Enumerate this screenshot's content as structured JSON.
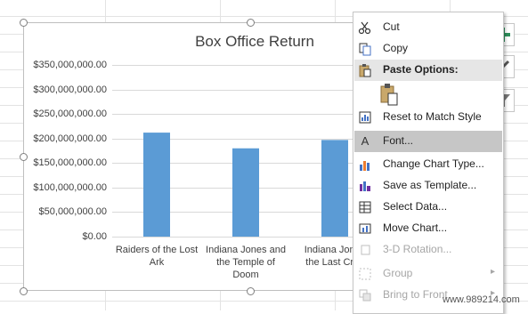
{
  "chart_data": {
    "type": "bar",
    "title": "Box Office Return",
    "categories": [
      "Raiders of the Lost Ark",
      "Indiana Jones and the Temple of Doom",
      "Indiana Jones and the Last Crusade"
    ],
    "category_label_lines": [
      [
        "Raiders of the Lost",
        "Ark"
      ],
      [
        "Indiana Jones and",
        "the Temple of",
        "Doom"
      ],
      [
        "Indiana Jones",
        "the Last Crus"
      ]
    ],
    "values": [
      212000000,
      180000000,
      197000000
    ],
    "ylim": [
      0,
      350000000
    ],
    "yticks": [
      0,
      50000000,
      100000000,
      150000000,
      200000000,
      250000000,
      300000000,
      350000000
    ],
    "ytick_labels": [
      "$0.00",
      "$50,000,000.00",
      "$100,000,000.00",
      "$150,000,000.00",
      "$200,000,000.00",
      "$250,000,000.00",
      "$300,000,000.00",
      "$350,000,000.00"
    ],
    "xlabel": "",
    "ylabel": "",
    "grid": true,
    "legend": "none",
    "bar_color": "#5b9bd5"
  },
  "side_buttons": [
    {
      "icon": "plus-icon"
    },
    {
      "icon": "brush-icon"
    },
    {
      "icon": "filter-icon"
    }
  ],
  "context_menu": {
    "items": [
      {
        "id": "cut",
        "label": "Cut",
        "icon": "scissors-icon",
        "state": "normal"
      },
      {
        "id": "copy",
        "label": "Copy",
        "icon": "copy-icon",
        "state": "normal"
      },
      {
        "id": "paste-options",
        "label": "Paste Options:",
        "icon": "clipboard-icon",
        "state": "section"
      },
      {
        "id": "reset-style",
        "label": "Reset to Match Style",
        "icon": "reset-style-icon",
        "state": "normal"
      },
      {
        "id": "font",
        "label": "Font...",
        "icon": "font-icon",
        "state": "highlight"
      },
      {
        "id": "change-chart-type",
        "label": "Change Chart Type...",
        "icon": "chart-type-icon",
        "state": "normal"
      },
      {
        "id": "save-template",
        "label": "Save as Template...",
        "icon": "template-icon",
        "state": "normal"
      },
      {
        "id": "select-data",
        "label": "Select Data...",
        "icon": "select-data-icon",
        "state": "normal"
      },
      {
        "id": "move-chart",
        "label": "Move Chart...",
        "icon": "move-chart-icon",
        "state": "normal"
      },
      {
        "id": "3d-rotation",
        "label": "3-D Rotation...",
        "icon": "rotation-icon",
        "state": "disabled"
      },
      {
        "id": "group",
        "label": "Group",
        "icon": "group-icon",
        "state": "disabled",
        "submenu": true
      },
      {
        "id": "bring-to-front",
        "label": "Bring to Front",
        "icon": "bring-front-icon",
        "state": "disabled",
        "submenu": true
      }
    ],
    "submenu_arrow": "▸"
  },
  "watermark": "www.989214.com"
}
